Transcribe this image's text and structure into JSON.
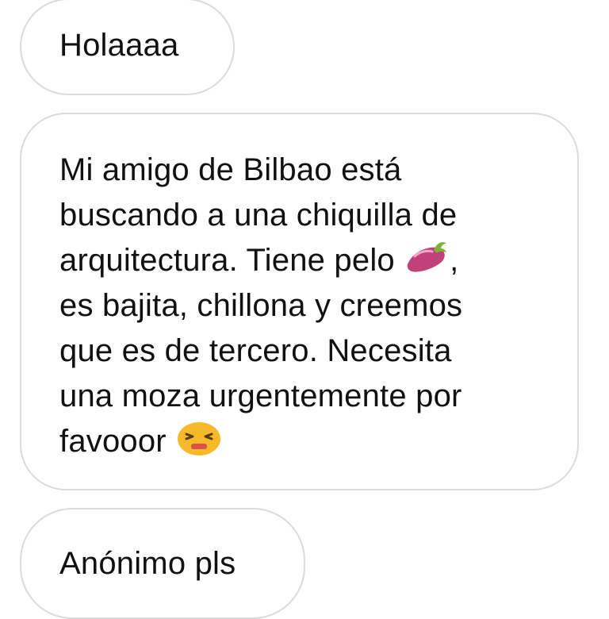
{
  "messages": [
    {
      "text": "Holaaaa"
    },
    {
      "lines": [
        "Mi amigo de Bilbao está",
        "buscando a una chiquilla de",
        "arquitectura. Tiene pelo ",
        ",",
        "es bajita, chillona y creemos",
        "que es de tercero. Necesita",
        "una moza urgentemente por",
        "favooor "
      ],
      "emojis": [
        "eggplant-emoji",
        "persevering-face-emoji"
      ]
    },
    {
      "text": "Anónimo pls"
    }
  ],
  "colors": {
    "background": "#ffffff",
    "bubble_border": "#dbdbdb",
    "text": "#111111",
    "eggplant": "#c2417a",
    "face": "#f6b92a"
  }
}
